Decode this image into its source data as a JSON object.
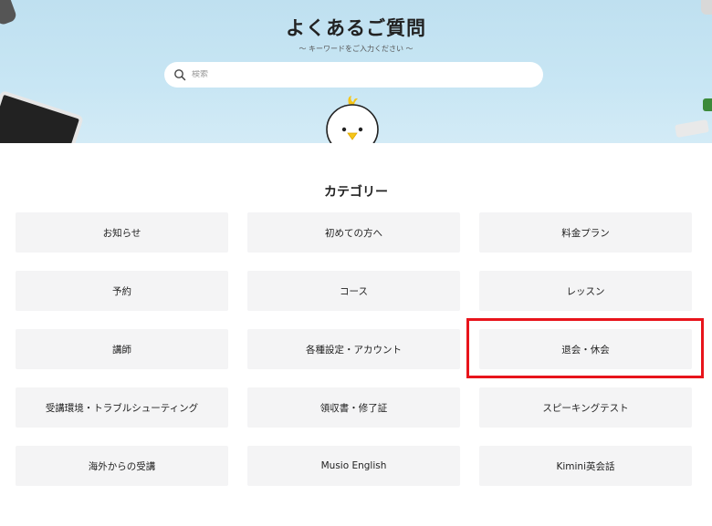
{
  "hero": {
    "title": "よくあるご質問",
    "subtitle": "〜 キーワードをご入力ください 〜",
    "search": {
      "placeholder": "検索",
      "value": ""
    }
  },
  "categories": {
    "title": "カテゴリー",
    "items": [
      {
        "label": "お知らせ"
      },
      {
        "label": "初めての方へ"
      },
      {
        "label": "料金プラン"
      },
      {
        "label": "予約"
      },
      {
        "label": "コース"
      },
      {
        "label": "レッスン"
      },
      {
        "label": "講師"
      },
      {
        "label": "各種設定・アカウント"
      },
      {
        "label": "退会・休会",
        "highlighted": true
      },
      {
        "label": "受講環境・トラブルシューティング"
      },
      {
        "label": "領収書・修了証"
      },
      {
        "label": "スピーキングテスト"
      },
      {
        "label": "海外からの受講"
      },
      {
        "label": "Musio English"
      },
      {
        "label": "Kimini英会話"
      }
    ]
  },
  "colors": {
    "hero_bg": "#c8e6f4",
    "card_bg": "#f4f4f5",
    "highlight": "#e8141b"
  }
}
